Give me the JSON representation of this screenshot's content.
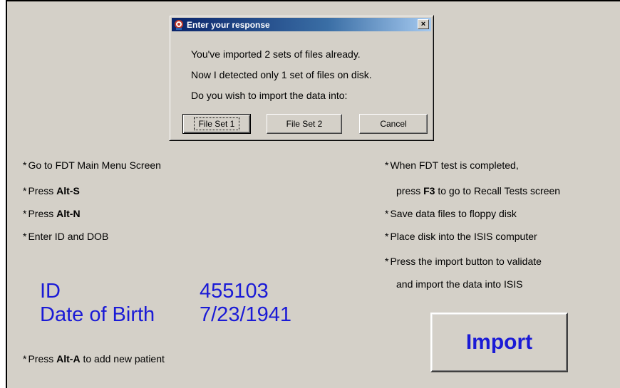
{
  "screen": {
    "instructions_left": [
      {
        "prefix": "Go to FDT Main Menu Screen",
        "key": "",
        "suffix": ""
      },
      {
        "prefix": "Press ",
        "key": "Alt-S",
        "suffix": ""
      },
      {
        "prefix": "Press ",
        "key": "Alt-N",
        "suffix": ""
      },
      {
        "prefix": "Enter ID and DOB",
        "key": "",
        "suffix": ""
      }
    ],
    "instructions_right": [
      {
        "prefix": "When FDT test is completed,",
        "key": "",
        "suffix": ""
      },
      {
        "prefix": "press ",
        "key": "F3",
        "suffix": " to go to Recall Tests screen"
      },
      {
        "prefix": "Save data files to floppy disk",
        "key": "",
        "suffix": ""
      },
      {
        "prefix": "Place disk into the ISIS computer",
        "key": "",
        "suffix": ""
      },
      {
        "prefix": "Press the import button to validate",
        "key": "",
        "suffix": ""
      },
      {
        "prefix": "and import the data into ISIS",
        "key": "",
        "suffix": ""
      }
    ],
    "star": "*",
    "patient": {
      "id_label": "ID",
      "id_value": "455103",
      "dob_label": "Date of Birth",
      "dob_value": "7/23/1941"
    },
    "add_patient": {
      "prefix": "Press ",
      "key": "Alt-A",
      "suffix": " to add new patient"
    },
    "import_button": "Import"
  },
  "dialog": {
    "title": "Enter your response",
    "close_glyph": "×",
    "messages": [
      "You've imported 2 sets of files already.",
      "Now I detected only 1 set of files on disk.",
      "Do you wish to import the data into:"
    ],
    "buttons": {
      "file_set_1": "File Set 1",
      "file_set_2": "File Set 2",
      "cancel": "Cancel"
    }
  },
  "colors": {
    "accent_text": "#1a1ad6",
    "titlebar_start": "#0a246a",
    "window_face": "#d4d0c8"
  }
}
